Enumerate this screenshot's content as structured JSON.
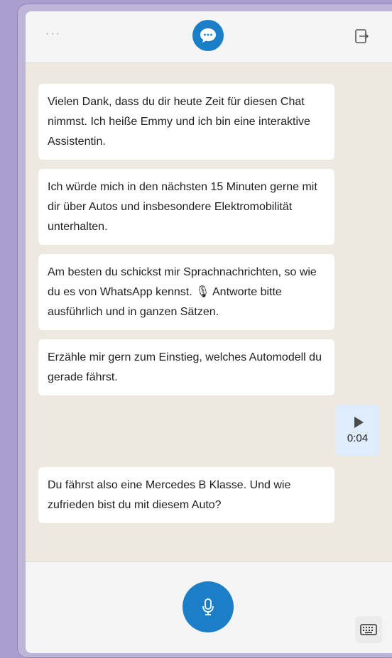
{
  "header": {
    "menu_label": "···",
    "logo_icon": "chat-bubble-icon",
    "exit_icon": "exit-icon",
    "accent_color": "#1a7fc7"
  },
  "messages": [
    {
      "sender": "assistant",
      "text": "Vielen Dank, dass du dir heute Zeit für diesen Chat nimmst. Ich heiße Emmy und ich bin eine interaktive Assistentin."
    },
    {
      "sender": "assistant",
      "text": "Ich würde mich in den nächsten 15 Minuten gerne mit dir über Autos und insbesondere Elektromobilität unterhalten."
    },
    {
      "sender": "assistant",
      "text": "Am besten du schickst mir Sprachnachrichten, so wie du es von WhatsApp kennst. 🎙 Antworte bitte ausführlich und in ganzen Sätzen."
    },
    {
      "sender": "assistant",
      "text": "Erzähle mir gern zum Einstieg, welches Automodell du gerade fährst."
    },
    {
      "sender": "user",
      "type": "audio",
      "duration": "0:04",
      "icon": "play-icon"
    },
    {
      "sender": "assistant",
      "text": "Du fährst also eine Mercedes B Klasse. Und wie zufrieden bist du mit diesem Auto?"
    }
  ],
  "footer": {
    "mic_icon": "microphone-icon",
    "keyboard_icon": "keyboard-icon"
  }
}
